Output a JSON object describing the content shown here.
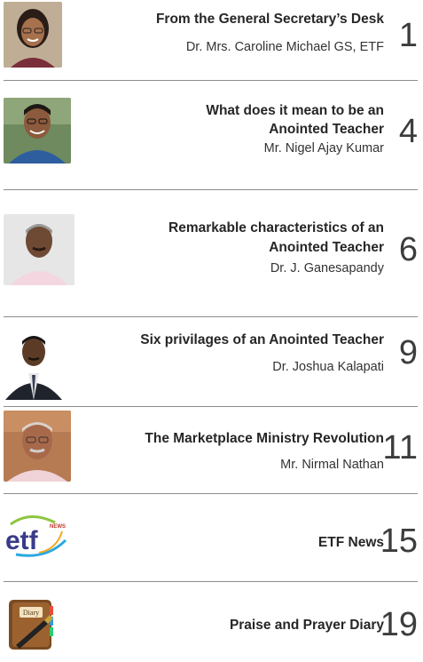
{
  "entries": [
    {
      "title": "From the General Secretary’s Desk",
      "author": "Dr. Mrs. Caroline Michael  GS, ETF",
      "page": "1"
    },
    {
      "title_line1": "What does it mean to be an",
      "title_line2": "Anointed Teacher",
      "author": "Mr. Nigel Ajay Kumar",
      "page": "4"
    },
    {
      "title_line1": "Remarkable characteristics of an",
      "title_line2": "Anointed Teacher",
      "author": "Dr. J. Ganesapandy",
      "page": "6"
    },
    {
      "title": "Six privilages of an Anointed Teacher",
      "author": "Dr. Joshua Kalapati",
      "page": "9"
    },
    {
      "title": "The Marketplace Ministry Revolution",
      "author": "Mr. Nirmal Nathan",
      "page": "11"
    },
    {
      "title": "ETF News",
      "page": "15",
      "logo_text": "etf",
      "logo_badge": "NEWS"
    },
    {
      "title": "Praise and Prayer Diary",
      "page": "19",
      "diary_label": "Diary"
    }
  ]
}
